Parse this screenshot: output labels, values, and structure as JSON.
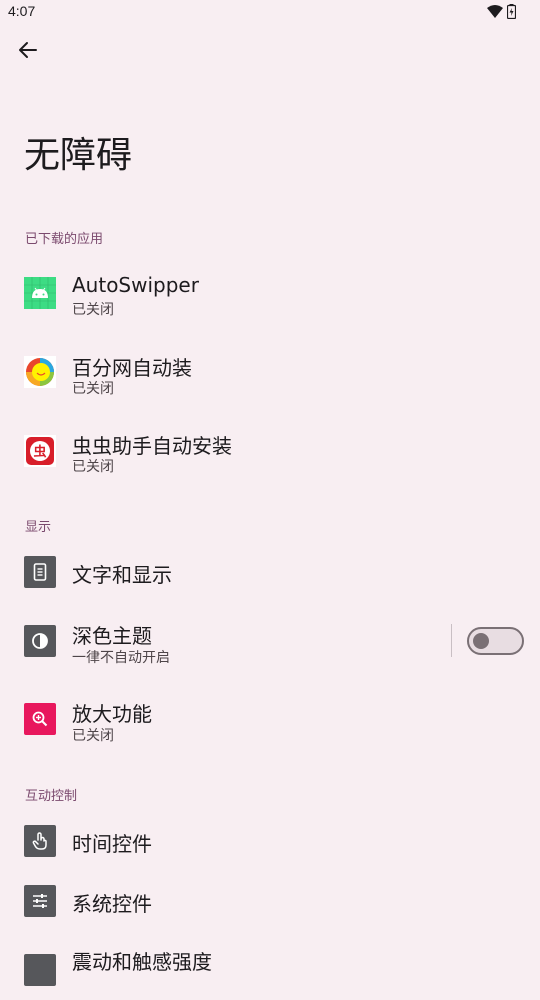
{
  "status_bar": {
    "time": "4:07",
    "icons": [
      "wifi-icon",
      "battery-icon"
    ]
  },
  "page": {
    "title": "无障碍"
  },
  "sections": {
    "downloaded_apps": {
      "header": "已下载的应用",
      "items": [
        {
          "title": "AutoSwipper",
          "subtitle": "已关闭",
          "icon": "android-app-icon"
        },
        {
          "title": "百分网自动装",
          "subtitle": "已关闭",
          "icon": "baifenwang-app-icon"
        },
        {
          "title": "虫虫助手自动安装",
          "subtitle": "已关闭",
          "icon": "chongchong-app-icon"
        }
      ]
    },
    "display": {
      "header": "显示",
      "items": [
        {
          "title": "文字和显示",
          "icon": "phone-text-icon"
        },
        {
          "title": "深色主题",
          "subtitle": "一律不自动开启",
          "icon": "contrast-icon",
          "toggle_on": false
        },
        {
          "title": "放大功能",
          "subtitle": "已关闭",
          "icon": "magnify-icon"
        }
      ]
    },
    "interaction": {
      "header": "互动控制",
      "items": [
        {
          "title": "时间控件",
          "icon": "touch-hand-icon"
        },
        {
          "title": "系统控件",
          "icon": "sliders-icon"
        },
        {
          "title": "震动和触感强度",
          "icon": "vibration-icon"
        }
      ]
    }
  },
  "colors": {
    "background": "#f8eef2",
    "section_header": "#7b4a6e",
    "magnify_icon_bg": "#e8175d",
    "setting_icon_bg": "#56575b",
    "android_icon_bg": "#3ddc84"
  }
}
